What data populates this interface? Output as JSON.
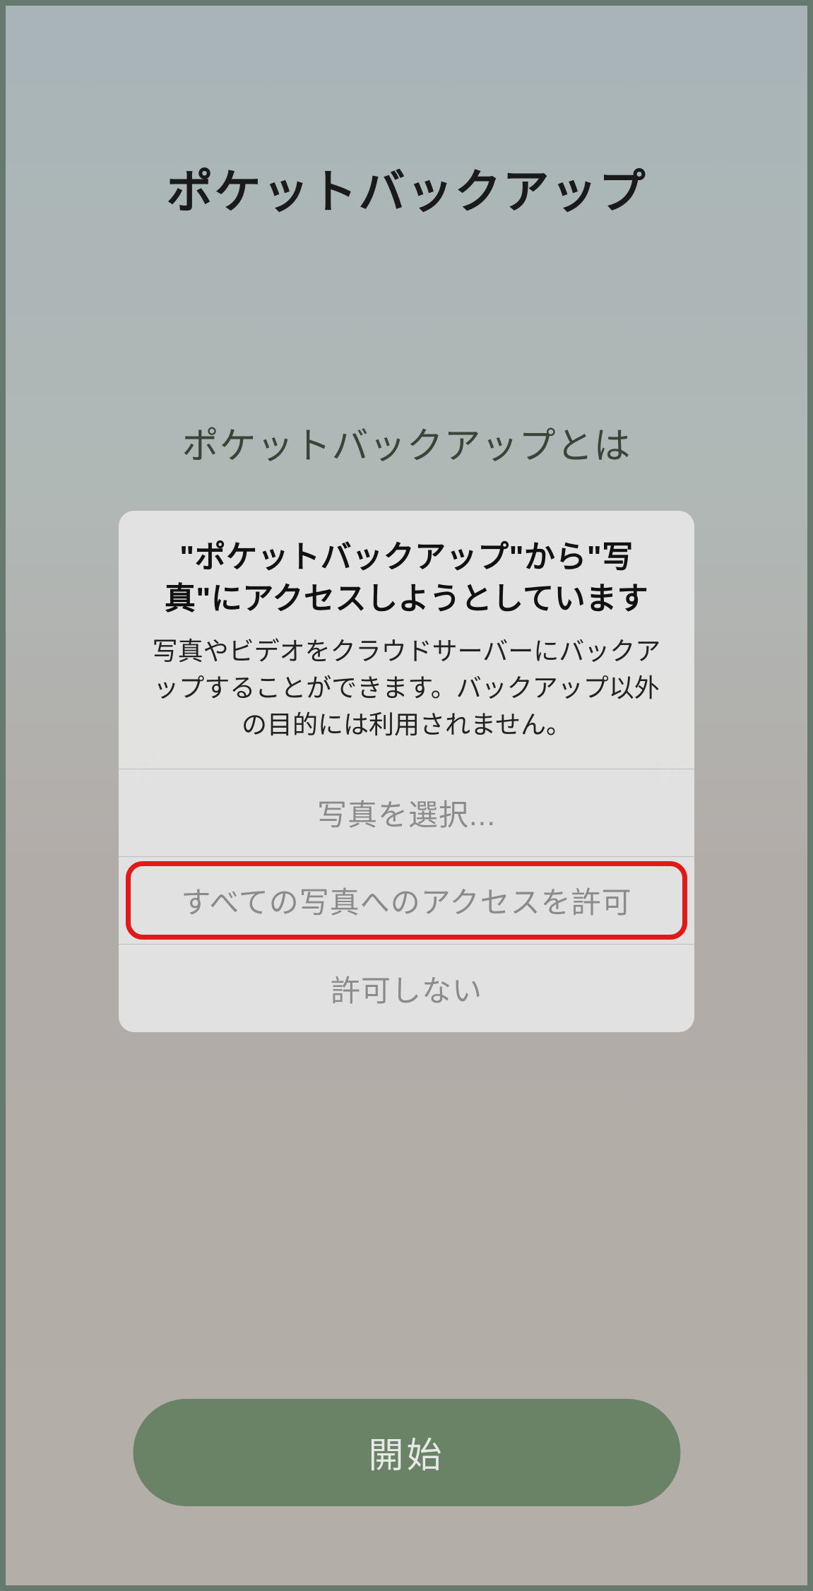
{
  "app": {
    "title": "ポケットバックアップ",
    "subtitle": "ポケットバックアップとは"
  },
  "alert": {
    "title": "\"ポケットバックアップ\"から\"写真\"にアクセスしようとしています",
    "message": "写真やビデオをクラウドサーバーにバックアップすることができます。バックアップ以外の目的には利用されません。",
    "buttons": {
      "select": "写真を選択...",
      "allow_all": "すべての写真へのアクセスを許可",
      "deny": "許可しない"
    }
  },
  "footer": {
    "start_label": "開始"
  },
  "colors": {
    "highlight": "#e01919",
    "primary_button": "#6a8366"
  }
}
